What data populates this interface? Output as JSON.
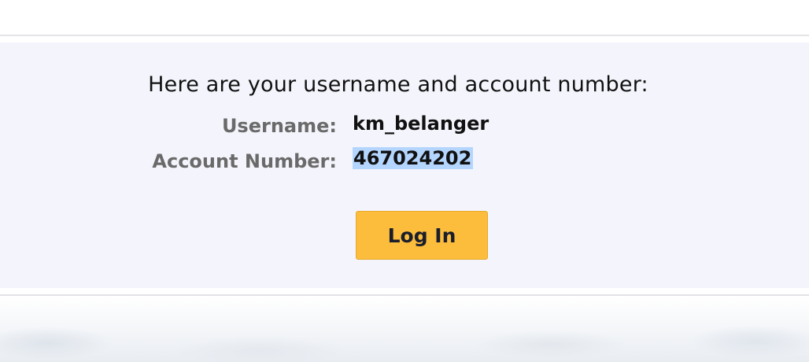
{
  "message": {
    "headline": "Here are your username and account number:"
  },
  "credentials": {
    "username_label": "Username:",
    "username_value": "km_belanger",
    "account_label": "Account Number:",
    "account_value": "467024202"
  },
  "actions": {
    "login_label": "Log In"
  },
  "colors": {
    "panel_bg": "#f4f5fc",
    "button_bg": "#fcbd3c",
    "selection_highlight": "#b4d5fe",
    "label_text": "#6a6a6a"
  }
}
